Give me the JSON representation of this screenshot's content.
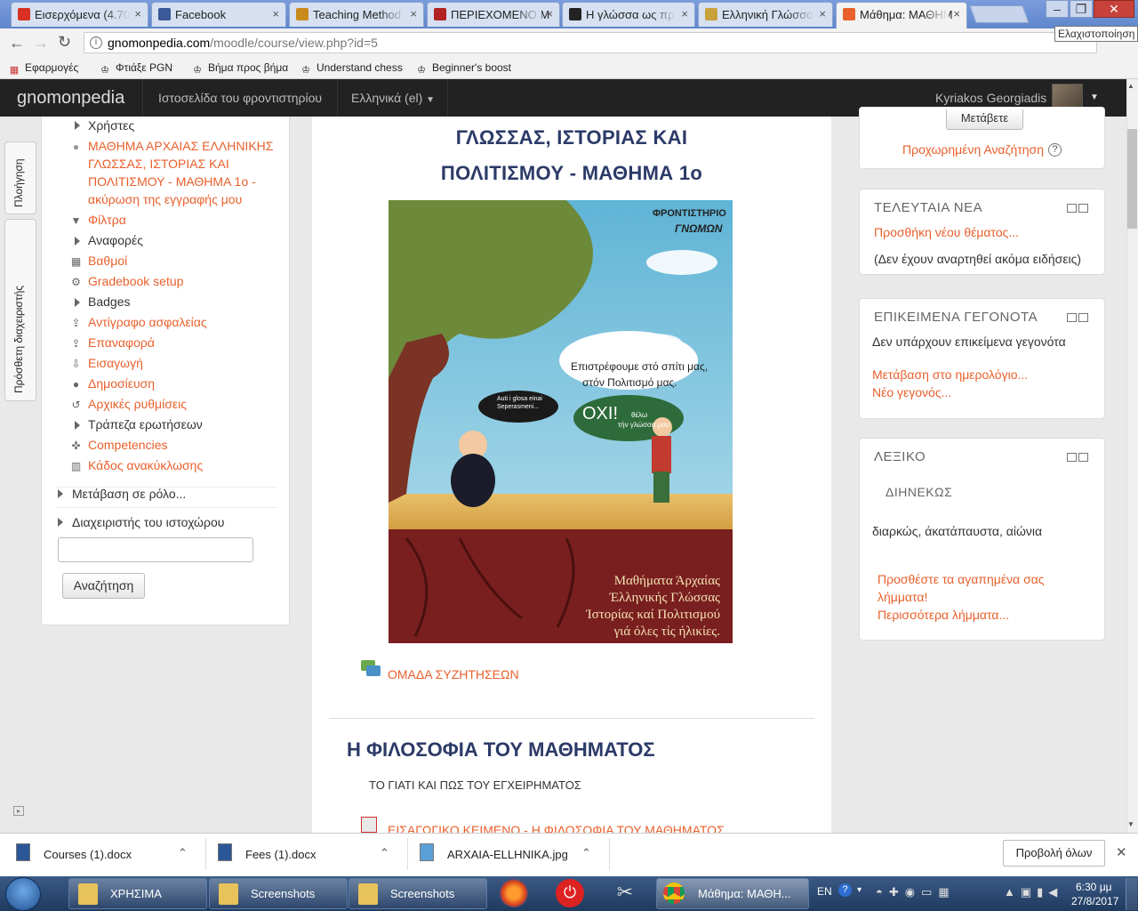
{
  "tabs": [
    {
      "label": "Εισερχόμενα (4.70",
      "icon": "gmail-icon",
      "color": "#d93025"
    },
    {
      "label": "Facebook",
      "icon": "facebook-icon",
      "color": "#3b5998"
    },
    {
      "label": "Teaching Method",
      "icon": "library-icon",
      "color": "#c98a1b"
    },
    {
      "label": "ΠΕΡΙΕΧΟΜΕΝΟ Μ",
      "icon": "bug-icon",
      "color": "#b22222"
    },
    {
      "label": "Η γλώσσα ως πρ",
      "icon": "b-icon",
      "color": "#222"
    },
    {
      "label": "Ελληνική Γλώσσα",
      "icon": "page-icon",
      "color": "#c9a13b"
    },
    {
      "label": "Μάθημα: ΜΑΘΗΜ",
      "icon": "moodle-icon",
      "color": "#e8602c"
    }
  ],
  "window": {
    "tooltip": "Ελαχιστοποίηση"
  },
  "address": {
    "host": "gnomonpedia.com",
    "path": "/moodle/course/view.php?id=5"
  },
  "bookmarks": [
    "Εφαρμογές",
    "Φτιάξε PGN",
    "Βήμα προς βήμα",
    "Understand chess",
    "Beginner's boost"
  ],
  "navbar": {
    "brand": "gnomonpedia",
    "site_link": "Ιστοσελίδα του φροντιστηρίου",
    "language": "Ελληνικά (el)",
    "user": "Kyriakos Georgiadis"
  },
  "dock": {
    "nav": "Πλοήγηση",
    "admin": "Πρόσθετη διαχειριστής"
  },
  "left_nav": {
    "users": "Χρήστες",
    "unenrol": [
      "ΜΑΘΗΜΑ ΑΡΧΑΙΑΣ ΕΛΛΗΝΙΚΗΣ",
      "ΓΛΩΣΣΑΣ, ΙΣΤΟΡΙΑΣ ΚΑΙ",
      "ΠΟΛΙΤΙΣΜΟΥ - ΜΑΘΗΜΑ 1ο -",
      "ακύρωση της εγγραφής μου"
    ],
    "items": [
      {
        "label": "Φίλτρα",
        "kind": "link",
        "icon": "filter-icon"
      },
      {
        "label": "Αναφορές",
        "kind": "plain",
        "icon": "arrow"
      },
      {
        "label": "Βαθμοί",
        "kind": "link",
        "icon": "grades-icon"
      },
      {
        "label": "Gradebook setup",
        "kind": "link",
        "icon": "gear-icon"
      },
      {
        "label": "Badges",
        "kind": "plain",
        "icon": "arrow"
      },
      {
        "label": "Αντίγραφο ασφαλείας",
        "kind": "link",
        "icon": "upload-icon"
      },
      {
        "label": "Επαναφορά",
        "kind": "link",
        "icon": "upload-icon"
      },
      {
        "label": "Εισαγωγή",
        "kind": "link",
        "icon": "download-icon"
      },
      {
        "label": "Δημοσίευση",
        "kind": "link",
        "icon": "globe-icon"
      },
      {
        "label": "Αρχικές ρυθμίσεις",
        "kind": "link",
        "icon": "reset-icon"
      },
      {
        "label": "Τράπεζα ερωτήσεων",
        "kind": "plain",
        "icon": "arrow"
      },
      {
        "label": "Competencies",
        "kind": "link",
        "icon": "competency-icon"
      },
      {
        "label": "Κάδος ανακύκλωσης",
        "kind": "link",
        "icon": "trash-icon"
      }
    ],
    "switch_role": "Μετάβαση σε ρόλο...",
    "site_admin": "Διαχειριστής του ιστοχώρου",
    "search_button": "Αναζήτηση"
  },
  "main": {
    "title_lines": [
      "ΓΛΩΣΣΑΣ, ΙΣΤΟΡΙΑΣ ΚΑΙ",
      "ΠΟΛΙΤΙΣΜΟΥ - ΜΑΘΗΜΑ 1ο"
    ],
    "poster": {
      "brand_top": "ΦΡΟΝΤΙΣΤΗΡΙΟ",
      "brand_name": "ΓΝΩΜΩΝ",
      "bubble_right": [
        "Επιστρέφουμε στό σπίτι μας,",
        "στόν Πολιτισμό μας."
      ],
      "bubble_left": [
        "Auti i glosa einai",
        "Seperasmeni..."
      ],
      "bubble_green_big": "ΟΧΙ!",
      "bubble_green_small": [
        "θέλω",
        "τήν γλώσσα μου"
      ],
      "caption": [
        "Μαθήματα Άρχαίας",
        "Έλληνικής Γλώσσας",
        "Ίστορίας καί Πολιτισμού",
        "γιά όλες τίς ήλικίες."
      ]
    },
    "forum_link": "ΟΜΑΔΑ ΣΥΖΗΤΗΣΕΩΝ",
    "section_title": "Η ΦΙΛΟΣΟΦΙΑ ΤΟΥ ΜΑΘΗΜΑΤΟΣ",
    "section_summary": "ΤΟ ΓΙΑΤΙ ΚΑΙ ΠΩΣ ΤΟΥ ΕΓΧΕΙΡΗΜΑΤΟΣ",
    "section_resource": "ΕΙΣΑΓΩΓΙΚΟ ΚΕΙΜΕΝΟ - Η ΦΙΛΟΣΟΦΙΑ ΤΟΥ ΜΑΘΗΜΑΤΟΣ"
  },
  "right": {
    "search_button": "Μετάβετε",
    "advanced_search": "Προχωρημένη Αναζήτηση",
    "news": {
      "title": "ΤΕΛΕΥΤΑΙΑ ΝΕΑ",
      "add": "Προσθήκη νέου θέματος...",
      "empty": "(Δεν έχουν αναρτηθεί ακόμα ειδήσεις)"
    },
    "events": {
      "title": "ΕΠΙΚΕΙΜΕΝΑ ΓΕΓΟΝΟΤΑ",
      "empty": "Δεν υπάρχουν επικείμενα γεγονότα",
      "calendar": "Μετάβαση στο ημερολόγιο...",
      "new_event": "Νέο γεγονός..."
    },
    "glossary": {
      "title": "ΛΕΞΙΚΟ",
      "term": "ΔΙΗΝΕΚΩΣ",
      "definition": "διαρκώς, άκατάπαυστα, αἰώνια",
      "add": [
        "Προσθέστε τα αγαπημένα σας",
        "λήμματα!"
      ],
      "more": "Περισσότερα λήμματα..."
    }
  },
  "downloads": {
    "files": [
      "Courses (1).docx",
      "Fees (1).docx",
      "ARXAIA-ELLHNIKA.jpg"
    ],
    "show_all": "Προβολή όλων"
  },
  "taskbar": {
    "items": [
      "ΧΡΗΣΙΜΑ",
      "Screenshots",
      "Screenshots",
      "Μάθημα: ΜΑΘΗ..."
    ],
    "lang": "EN",
    "time": "6:30 μμ",
    "date": "27/8/2017"
  }
}
